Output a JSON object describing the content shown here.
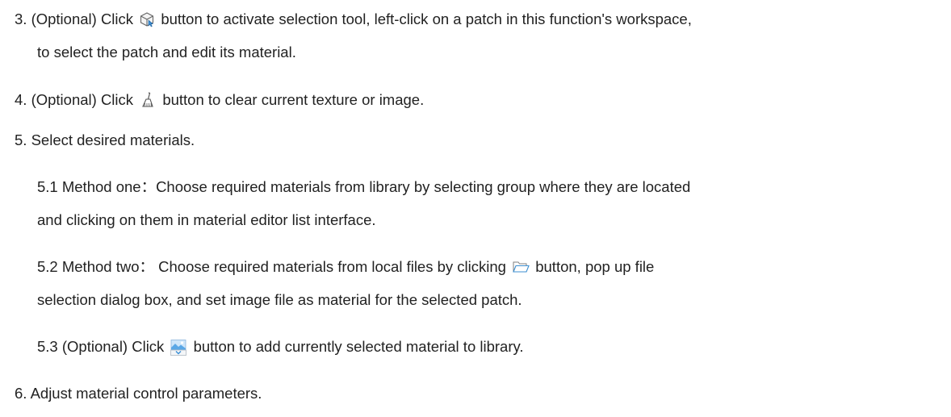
{
  "steps": {
    "s3": {
      "number": "3.",
      "line1_before": "(Optional) Click",
      "line1_after": "button to activate selection tool, left-click on a patch in this function's workspace,",
      "line2": "to select the patch and edit its material.",
      "icon": "selection-cube-icon"
    },
    "s4": {
      "number": "4.",
      "before": "(Optional) Click",
      "after": "button to clear current texture or image.",
      "icon": "brush-clear-icon"
    },
    "s5": {
      "number": "5.",
      "text": "Select desired materials.",
      "m1": {
        "line1": "5.1 Method one：Choose required materials from library by selecting group where they are located",
        "line2": "and clicking on them in material editor list interface."
      },
      "m2": {
        "line1_before": "5.2 Method two： Choose required materials from local files by clicking",
        "line1_after": "button, pop up file",
        "line2": "selection dialog box, and set image file as material for the selected patch.",
        "icon": "folder-icon"
      },
      "m3": {
        "before": "5.3 (Optional) Click",
        "after": "button to add currently selected material to library.",
        "icon": "add-to-library-icon"
      }
    },
    "s6": {
      "number": "6.",
      "text": "Adjust material control parameters."
    }
  }
}
